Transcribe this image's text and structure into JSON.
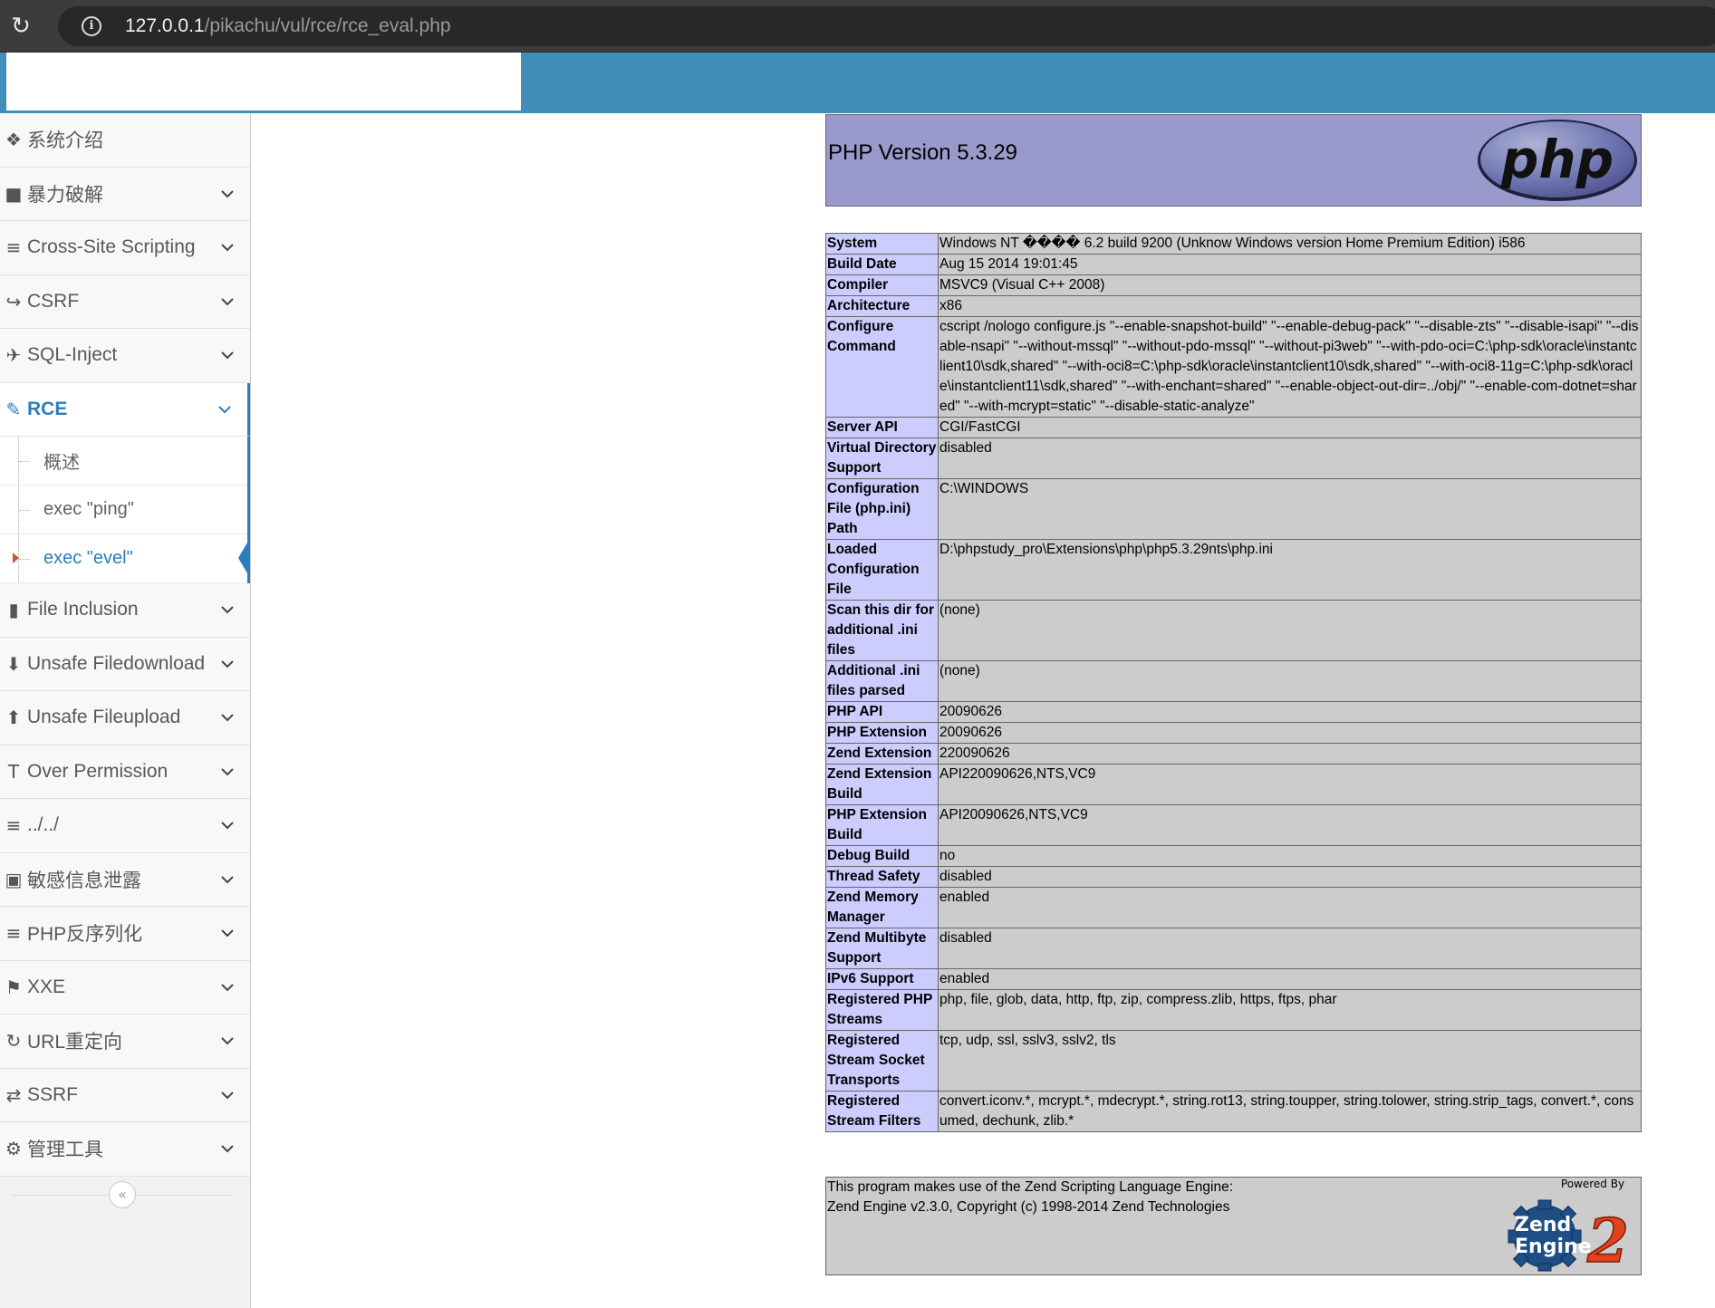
{
  "browser": {
    "url_host": "127.0.0.1",
    "url_path": "/pikachu/vul/rce/rce_eval.php"
  },
  "sidebar": {
    "items": [
      {
        "label": "系统介绍",
        "icon": "tag-icon",
        "glyph": "❖",
        "has_arrow": false
      },
      {
        "label": "暴力破解",
        "icon": "lock-icon",
        "glyph": "■",
        "has_arrow": true
      },
      {
        "label": "Cross-Site Scripting",
        "icon": "list-tree-icon",
        "glyph": "≡",
        "has_arrow": true
      },
      {
        "label": "CSRF",
        "icon": "share-icon",
        "glyph": "↪",
        "has_arrow": true
      },
      {
        "label": "SQL-Inject",
        "icon": "plane-icon",
        "glyph": "✈",
        "has_arrow": true
      },
      {
        "label": "RCE",
        "icon": "pencil-icon",
        "glyph": "✎",
        "has_arrow": true,
        "active": true
      }
    ],
    "rce_sub": [
      {
        "label": "概述"
      },
      {
        "label": "exec \"ping\""
      },
      {
        "label": "exec \"evel\"",
        "current": true
      }
    ],
    "items_after": [
      {
        "label": "File Inclusion",
        "icon": "file-icon",
        "glyph": "▮"
      },
      {
        "label": "Unsafe Filedownload",
        "icon": "download-icon",
        "glyph": "⬇"
      },
      {
        "label": "Unsafe Fileupload",
        "icon": "upload-icon",
        "glyph": "⬆"
      },
      {
        "label": "Over Permission",
        "icon": "text-height-icon",
        "glyph": "T"
      },
      {
        "label": "../../",
        "icon": "align-left-icon",
        "glyph": "≡"
      },
      {
        "label": "敏感信息泄露",
        "icon": "camera-icon",
        "glyph": "▣"
      },
      {
        "label": "PHP反序列化",
        "icon": "align-justify-icon",
        "glyph": "≡"
      },
      {
        "label": "XXE",
        "icon": "flag-icon",
        "glyph": "⚑"
      },
      {
        "label": "URL重定向",
        "icon": "refresh-icon",
        "glyph": "↻"
      },
      {
        "label": "SSRF",
        "icon": "exchange-icon",
        "glyph": "⇄"
      },
      {
        "label": "管理工具",
        "icon": "cog-icon",
        "glyph": "⚙"
      }
    ],
    "collapse_glyph": "«"
  },
  "phpinfo": {
    "version_title": "PHP Version 5.3.29",
    "logo_text": "php",
    "rows": [
      {
        "k": "System",
        "v": "Windows NT ���� 6.2 build 9200 (Unknow Windows version Home Premium Edition) i586"
      },
      {
        "k": "Build Date",
        "v": "Aug 15 2014 19:01:45"
      },
      {
        "k": "Compiler",
        "v": "MSVC9 (Visual C++ 2008)"
      },
      {
        "k": "Architecture",
        "v": "x86"
      },
      {
        "k": "Configure Command",
        "v": "cscript /nologo configure.js \"--enable-snapshot-build\" \"--enable-debug-pack\" \"--disable-zts\" \"--disable-isapi\" \"--disable-nsapi\" \"--without-mssql\" \"--without-pdo-mssql\" \"--without-pi3web\" \"--with-pdo-oci=C:\\php-sdk\\oracle\\instantclient10\\sdk,shared\" \"--with-oci8=C:\\php-sdk\\oracle\\instantclient10\\sdk,shared\" \"--with-oci8-11g=C:\\php-sdk\\oracle\\instantclient11\\sdk,shared\" \"--with-enchant=shared\" \"--enable-object-out-dir=../obj/\" \"--enable-com-dotnet=shared\" \"--with-mcrypt=static\" \"--disable-static-analyze\""
      },
      {
        "k": "Server API",
        "v": "CGI/FastCGI"
      },
      {
        "k": "Virtual Directory Support",
        "v": "disabled"
      },
      {
        "k": "Configuration File (php.ini) Path",
        "v": "C:\\WINDOWS"
      },
      {
        "k": "Loaded Configuration File",
        "v": "D:\\phpstudy_pro\\Extensions\\php\\php5.3.29nts\\php.ini"
      },
      {
        "k": "Scan this dir for additional .ini files",
        "v": "(none)"
      },
      {
        "k": "Additional .ini files parsed",
        "v": "(none)"
      },
      {
        "k": "PHP API",
        "v": "20090626"
      },
      {
        "k": "PHP Extension",
        "v": "20090626"
      },
      {
        "k": "Zend Extension",
        "v": "220090626"
      },
      {
        "k": "Zend Extension Build",
        "v": "API220090626,NTS,VC9"
      },
      {
        "k": "PHP Extension Build",
        "v": "API20090626,NTS,VC9"
      },
      {
        "k": "Debug Build",
        "v": "no"
      },
      {
        "k": "Thread Safety",
        "v": "disabled"
      },
      {
        "k": "Zend Memory Manager",
        "v": "enabled"
      },
      {
        "k": "Zend Multibyte Support",
        "v": "disabled"
      },
      {
        "k": "IPv6 Support",
        "v": "enabled"
      },
      {
        "k": "Registered PHP Streams",
        "v": "php, file, glob, data, http, ftp, zip, compress.zlib, https, ftps, phar"
      },
      {
        "k": "Registered Stream Socket Transports",
        "v": "tcp, udp, ssl, sslv3, sslv2, tls"
      },
      {
        "k": "Registered Stream Filters",
        "v": "convert.iconv.*, mcrypt.*, mdecrypt.*, string.rot13, string.toupper, string.tolower, string.strip_tags, convert.*, consumed, dechunk, zlib.*"
      }
    ],
    "zend_line1": "This program makes use of the Zend Scripting Language Engine:",
    "zend_line2": "Zend Engine v2.3.0, Copyright (c) 1998-2014 Zend Technologies",
    "zend_logo_powered": "Powered By",
    "zend_logo_line1": "Zend",
    "zend_logo_line2": "Engine",
    "zend_logo_num": "2"
  },
  "colors": {
    "topbar": "#438eb9",
    "accent": "#2b7dbc",
    "php_header": "#9999cc",
    "php_key": "#ccccff",
    "php_value": "#cccccc"
  }
}
